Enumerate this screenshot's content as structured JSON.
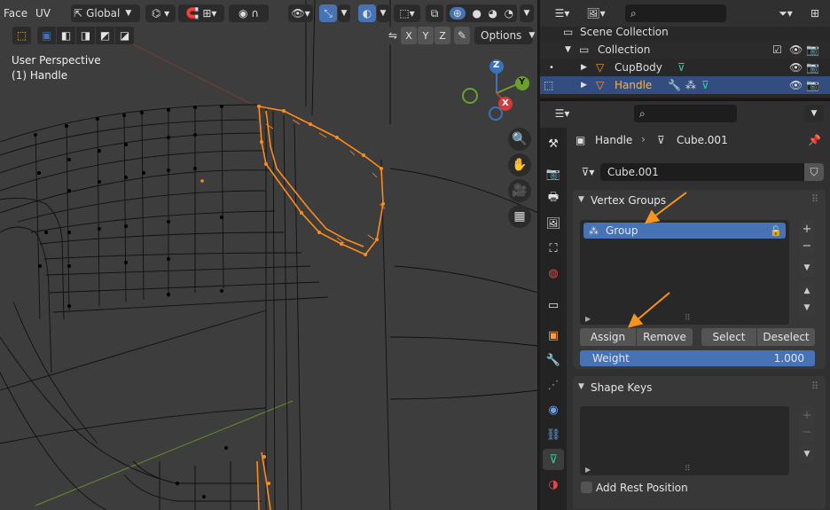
{
  "viewport": {
    "header": {
      "mode_partial": "Face",
      "uv_menu": "UV",
      "orientation": "Global",
      "options_label": "Options",
      "axes": [
        "X",
        "Y",
        "Z"
      ]
    },
    "overlay": {
      "perspective": "User Perspective",
      "object": "(1) Handle"
    },
    "gizmo": {
      "z": "Z",
      "y": "Y",
      "x": "X"
    }
  },
  "outliner": {
    "rows": [
      {
        "label": "Scene Collection"
      },
      {
        "label": "Collection"
      },
      {
        "label": "CupBody"
      },
      {
        "label": "Handle"
      }
    ]
  },
  "properties": {
    "breadcrumb": {
      "object": "Handle",
      "data": "Cube.001"
    },
    "mesh_name": "Cube.001",
    "vertex_groups": {
      "title": "Vertex Groups",
      "items": [
        {
          "name": "Group"
        }
      ],
      "buttons": {
        "assign": "Assign",
        "remove": "Remove",
        "select": "Select",
        "deselect": "Deselect"
      },
      "weight_label": "Weight",
      "weight_value": "1.000"
    },
    "shape_keys": {
      "title": "Shape Keys",
      "add_rest_position": "Add Rest Position"
    }
  },
  "colors": {
    "selection_blue": "#4772b3",
    "edge_orange": "#ff8c1a",
    "annotation_orange": "#f7941d",
    "viewport_bg": "#3d3d3d"
  }
}
